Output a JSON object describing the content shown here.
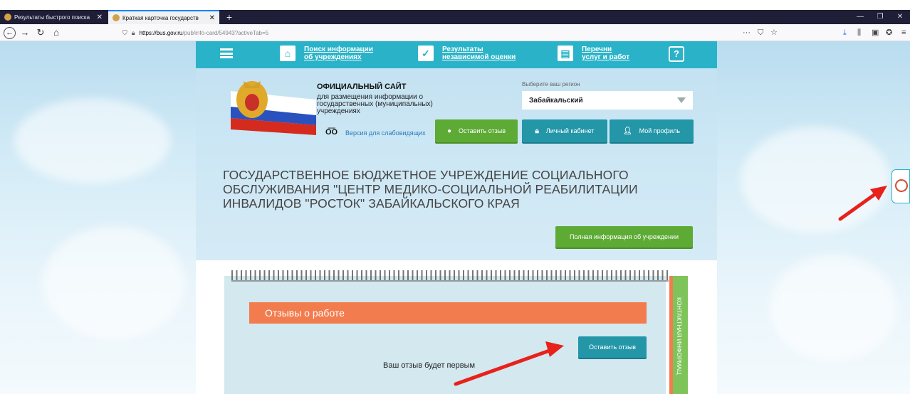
{
  "browser": {
    "tabs": [
      {
        "title": "Результаты быстрого поиска",
        "active": false
      },
      {
        "title": "Краткая карточка государств",
        "active": true
      }
    ],
    "new_tab": "+",
    "url_host": "https://bus.gov.ru",
    "url_path": "/pub/info-card/54943?activeTab=5",
    "url_right_icons": [
      "more-icon",
      "pocket-icon",
      "bookmark-star-icon"
    ],
    "toolbar_icons": [
      "download-icon",
      "library-icon",
      "sidebar-icon",
      "extension-icon",
      "menu-icon"
    ]
  },
  "menu": {
    "items": [
      {
        "line1": "Поиск информации",
        "line2": "об учреждениях",
        "icon": "institution-icon"
      },
      {
        "line1": "Результаты",
        "line2": "независимой оценки",
        "icon": "check-icon"
      },
      {
        "line1": "Перечни",
        "line2": "услуг и работ",
        "icon": "briefcase-icon"
      }
    ],
    "help_icon": "?"
  },
  "header": {
    "site_title": "ОФИЦИАЛЬНЫЙ САЙТ",
    "site_subtitle": "для размещения информации о государственных (муниципальных) учреждениях",
    "low_vision": "Версия для слабовидящих",
    "region_label": "Выберите ваш регион",
    "region_value": "Забайкальский",
    "leave_review": "Оставить отзыв",
    "personal_cabinet": "Личный кабинет",
    "my_profile": "Мой профиль"
  },
  "organization": {
    "name": "ГОСУДАРСТВЕННОЕ БЮДЖЕТНОЕ УЧРЕЖДЕНИЕ СОЦИАЛЬНОГО ОБСЛУЖИВАНИЯ \"ЦЕНТР МЕДИКО-СОЦИАЛЬНОЙ РЕАБИЛИТАЦИИ ИНВАЛИДОВ \"РОСТОК\" ЗАБАЙКАЛЬСКОГО КРАЯ",
    "full_info_button": "Полная информация об учреждении"
  },
  "reviews": {
    "title": "Отзывы о работе",
    "leave_review": "Оставить отзыв",
    "empty_message": "Ваш отзыв будет первым",
    "side_tab": "КОНТАКТНАЯ ИНФОРМАЦ"
  },
  "colors": {
    "menu_teal": "#2ab3c8",
    "button_green": "#5daa35",
    "button_teal": "#2396a8",
    "reviews_orange": "#f37c4e",
    "annotation_arrow": "#e8211b"
  }
}
